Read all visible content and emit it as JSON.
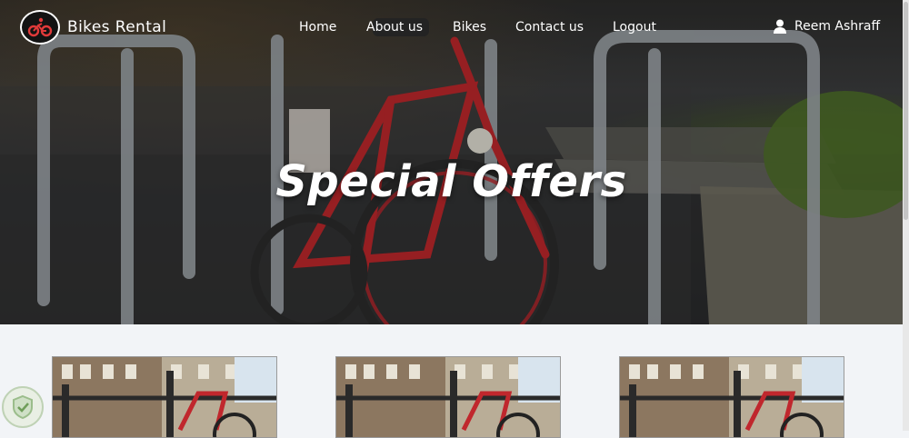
{
  "navbar": {
    "brand": "Bikes Rental",
    "links": [
      "Home",
      "About us",
      "Bikes",
      "Contact us",
      "Logout"
    ],
    "user_name": "Reem Ashraff"
  },
  "hero": {
    "title": "Special Offers"
  },
  "icons": {
    "logo": "bicycle-rider-icon",
    "user": "user-icon",
    "badge": "shield-check-icon"
  },
  "colors": {
    "logo_accent": "#e03a3a",
    "bike_red": "#b8262a",
    "page_bg": "#f2f4f7"
  },
  "offers": {
    "cards": [
      {
        "image": "red-bicycle-city-photo"
      },
      {
        "image": "red-bicycle-city-photo"
      },
      {
        "image": "red-bicycle-city-photo"
      }
    ]
  }
}
